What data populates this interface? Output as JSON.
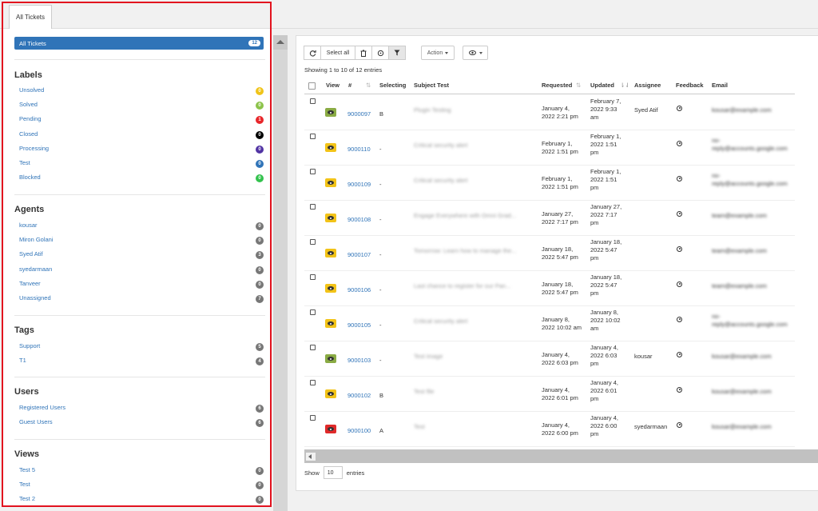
{
  "tabs": [
    "All Tickets"
  ],
  "sidebar": {
    "all_tickets": {
      "label": "All Tickets",
      "count": "12"
    },
    "sections": [
      {
        "title": "Labels",
        "items": [
          {
            "label": "Unsolved",
            "count": "0",
            "color": "#f0c419"
          },
          {
            "label": "Solved",
            "count": "0",
            "color": "#8cc34a"
          },
          {
            "label": "Pending",
            "count": "1",
            "color": "#e8262a"
          },
          {
            "label": "Closed",
            "count": "0",
            "color": "#000000"
          },
          {
            "label": "Processing",
            "count": "0",
            "color": "#5133a3"
          },
          {
            "label": "Test",
            "count": "0",
            "color": "#3074b8"
          },
          {
            "label": "Blocked",
            "count": "0",
            "color": "#33c24d"
          }
        ]
      },
      {
        "title": "Agents",
        "items": [
          {
            "label": "kousar",
            "count": "0",
            "color": "#777777"
          },
          {
            "label": "Miron Golani",
            "count": "0",
            "color": "#777777"
          },
          {
            "label": "Syed Atif",
            "count": "3",
            "color": "#777777"
          },
          {
            "label": "syedarmaan",
            "count": "0",
            "color": "#777777"
          },
          {
            "label": "Tanveer",
            "count": "0",
            "color": "#777777"
          },
          {
            "label": "Unassigned",
            "count": "7",
            "color": "#777777"
          }
        ]
      },
      {
        "title": "Tags",
        "items": [
          {
            "label": "Support",
            "count": "5",
            "color": "#777777"
          },
          {
            "label": "T1",
            "count": "4",
            "color": "#777777"
          }
        ]
      },
      {
        "title": "Users",
        "items": [
          {
            "label": "Registered Users",
            "count": "6",
            "color": "#777777"
          },
          {
            "label": "Guest Users",
            "count": "6",
            "color": "#777777"
          }
        ]
      },
      {
        "title": "Views",
        "items": [
          {
            "label": "Test 5",
            "count": "0",
            "color": "#777777"
          },
          {
            "label": "Test",
            "count": "0",
            "color": "#777777"
          },
          {
            "label": "Test 2",
            "count": "0",
            "color": "#777777"
          }
        ]
      }
    ]
  },
  "toolbar": {
    "refresh_icon": "refresh-icon",
    "select_all": "Select all",
    "action": "Action",
    "eye_menu_icon": "eye-icon"
  },
  "table": {
    "info": "Showing 1 to 10 of 12 entries",
    "headers": [
      "View",
      "#",
      "Selecting",
      "Subject Test",
      "Requested",
      "Updated",
      "Assignee",
      "Feedback",
      "Email"
    ],
    "rows": [
      {
        "view": "#8aab44",
        "num": "9000097",
        "sel": "B",
        "subject": "Plugin Testing",
        "req": [
          "January 4,",
          "2022 2:21 pm"
        ],
        "upd": [
          "February 7,",
          "2022 9:33",
          "am"
        ],
        "assignee": "Syed Atif",
        "email": [
          "kousar@example.com"
        ]
      },
      {
        "view": "#f2c318",
        "num": "9000110",
        "sel": "-",
        "subject": "Critical security alert",
        "req": [
          "February 1,",
          "2022 1:51 pm"
        ],
        "upd": [
          "February 1,",
          "2022 1:51",
          "pm"
        ],
        "assignee": "",
        "email": [
          "no-",
          "reply@accounts.google.com"
        ]
      },
      {
        "view": "#f2c318",
        "num": "9000109",
        "sel": "-",
        "subject": "Critical security alert",
        "req": [
          "February 1,",
          "2022 1:51 pm"
        ],
        "upd": [
          "February 1,",
          "2022 1:51",
          "pm"
        ],
        "assignee": "",
        "email": [
          "no-",
          "reply@accounts.google.com"
        ]
      },
      {
        "view": "#f2c318",
        "num": "9000108",
        "sel": "-",
        "subject": "Engage Everywhere with Omni Grad...",
        "req": [
          "January 27,",
          "2022 7:17 pm"
        ],
        "upd": [
          "January 27,",
          "2022 7:17",
          "pm"
        ],
        "assignee": "",
        "email": [
          "team@example.com"
        ]
      },
      {
        "view": "#f2c318",
        "num": "9000107",
        "sel": "-",
        "subject": "Tomorrow: Learn how to manage the...",
        "req": [
          "January 18,",
          "2022 5:47 pm"
        ],
        "upd": [
          "January 18,",
          "2022 5:47",
          "pm"
        ],
        "assignee": "",
        "email": [
          "team@example.com"
        ]
      },
      {
        "view": "#f2c318",
        "num": "9000106",
        "sel": "-",
        "subject": "Last chance to register for our Pan...",
        "req": [
          "January 18,",
          "2022 5:47 pm"
        ],
        "upd": [
          "January 18,",
          "2022 5:47",
          "pm"
        ],
        "assignee": "",
        "email": [
          "team@example.com"
        ]
      },
      {
        "view": "#f2c318",
        "num": "9000105",
        "sel": "-",
        "subject": "Critical security alert",
        "req": [
          "January 8,",
          "2022 10:02 am"
        ],
        "upd": [
          "January 8,",
          "2022 10:02",
          "am"
        ],
        "assignee": "",
        "email": [
          "no-",
          "reply@accounts.google.com"
        ]
      },
      {
        "view": "#8aab44",
        "num": "9000103",
        "sel": "-",
        "subject": "Test image",
        "req": [
          "January 4,",
          "2022 6:03 pm"
        ],
        "upd": [
          "January 4,",
          "2022 6:03",
          "pm"
        ],
        "assignee": "kousar",
        "email": [
          "kousar@example.com"
        ]
      },
      {
        "view": "#f2c318",
        "num": "9000102",
        "sel": "B",
        "subject": "Test file",
        "req": [
          "January 4,",
          "2022 6:01 pm"
        ],
        "upd": [
          "January 4,",
          "2022 6:01",
          "pm"
        ],
        "assignee": "",
        "email": [
          "kousar@example.com"
        ]
      },
      {
        "view": "#e02a2a",
        "num": "9000100",
        "sel": "A",
        "subject": "Test",
        "req": [
          "January 4,",
          "2022 6:00 pm"
        ],
        "upd": [
          "January 4,",
          "2022 6:00",
          "pm"
        ],
        "assignee": "syedarmaan",
        "email": [
          "kousar@example.com"
        ]
      }
    ]
  },
  "footer": {
    "show": "Show",
    "length": "10",
    "entries": "entries"
  }
}
